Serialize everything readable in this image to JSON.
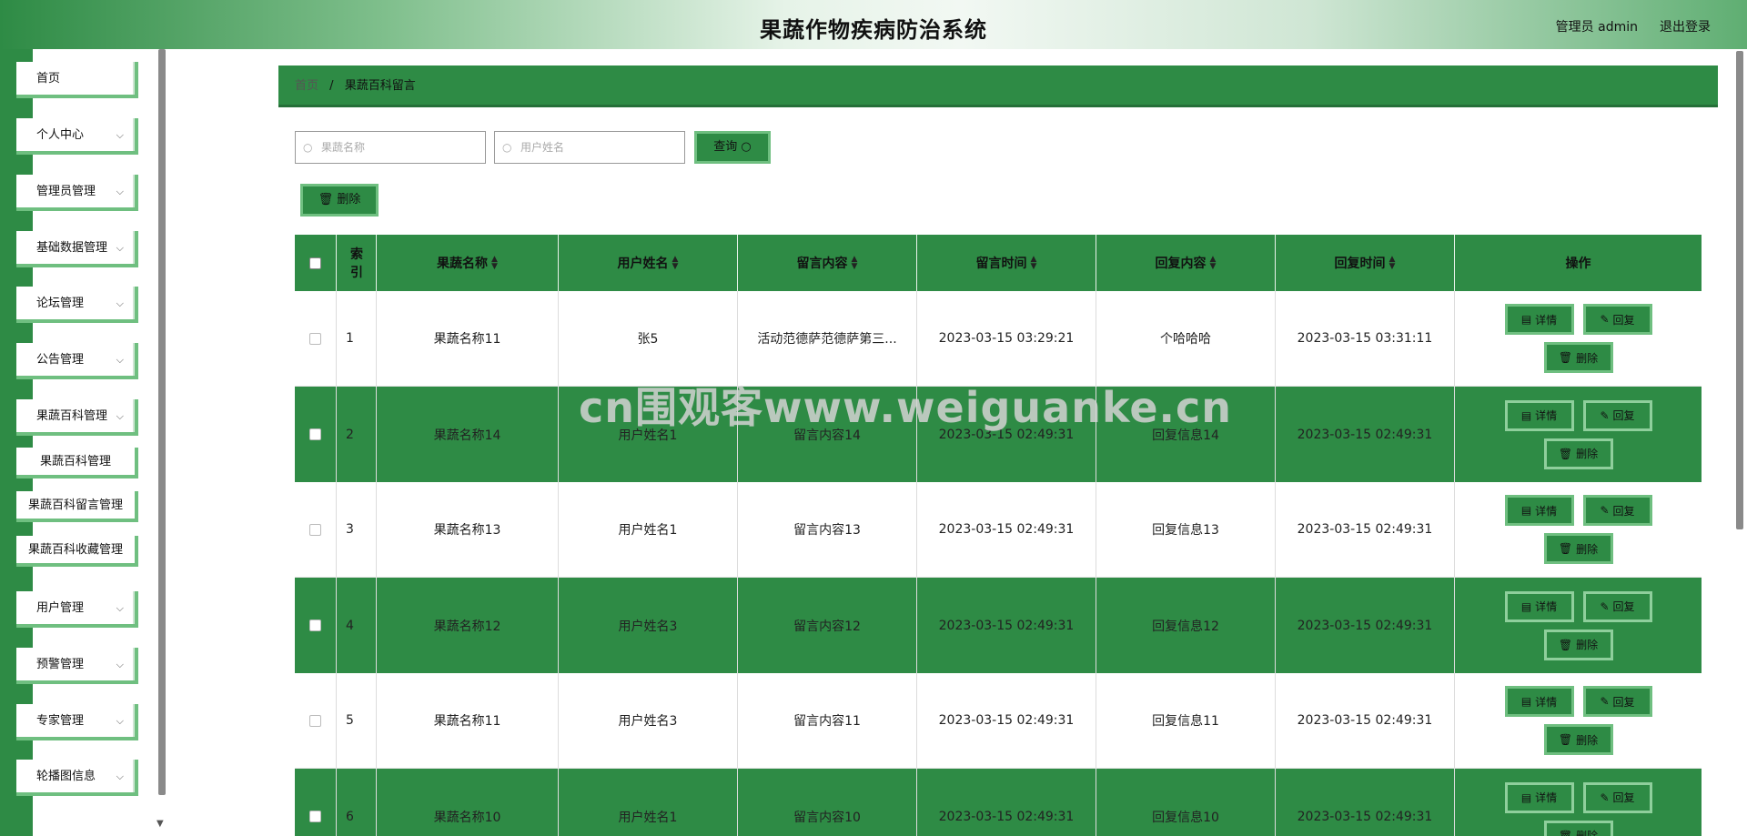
{
  "header": {
    "title": "果蔬作物疾病防治系统",
    "user": "管理员 admin",
    "logout": "退出登录"
  },
  "sidebar": {
    "items": [
      {
        "label": "首页",
        "chevron": false
      },
      {
        "label": "个人中心",
        "chevron": true
      },
      {
        "label": "管理员管理",
        "chevron": true
      },
      {
        "label": "基础数据管理",
        "chevron": true
      },
      {
        "label": "论坛管理",
        "chevron": true
      },
      {
        "label": "公告管理",
        "chevron": true
      },
      {
        "label": "果蔬百科管理",
        "chevron": true
      }
    ],
    "subitems": [
      "果蔬百科管理",
      "果蔬百科留言管理",
      "果蔬百科收藏管理"
    ],
    "items_after": [
      {
        "label": "用户管理",
        "chevron": true
      },
      {
        "label": "预警管理",
        "chevron": true
      },
      {
        "label": "专家管理",
        "chevron": true
      },
      {
        "label": "轮播图信息",
        "chevron": true
      }
    ]
  },
  "breadcrumb": {
    "home": "首页",
    "separator": "/",
    "current": "果蔬百科留言"
  },
  "search": {
    "fruit_placeholder": "果蔬名称",
    "user_placeholder": "用户姓名",
    "query_label": "查询",
    "delete_label": "删除"
  },
  "table": {
    "headers": [
      "索引",
      "果蔬名称",
      "用户姓名",
      "留言内容",
      "留言时间",
      "回复内容",
      "回复时间",
      "操作"
    ],
    "rows": [
      {
        "index": "1",
        "fruit": "果蔬名称11",
        "user": "张5",
        "content": "活动范德萨范德萨第三...",
        "time": "2023-03-15 03:29:21",
        "reply": "个哈哈哈",
        "reply_time": "2023-03-15 03:31:11"
      },
      {
        "index": "2",
        "fruit": "果蔬名称14",
        "user": "用户姓名1",
        "content": "留言内容14",
        "time": "2023-03-15 02:49:31",
        "reply": "回复信息14",
        "reply_time": "2023-03-15 02:49:31"
      },
      {
        "index": "3",
        "fruit": "果蔬名称13",
        "user": "用户姓名1",
        "content": "留言内容13",
        "time": "2023-03-15 02:49:31",
        "reply": "回复信息13",
        "reply_time": "2023-03-15 02:49:31"
      },
      {
        "index": "4",
        "fruit": "果蔬名称12",
        "user": "用户姓名3",
        "content": "留言内容12",
        "time": "2023-03-15 02:49:31",
        "reply": "回复信息12",
        "reply_time": "2023-03-15 02:49:31"
      },
      {
        "index": "5",
        "fruit": "果蔬名称11",
        "user": "用户姓名3",
        "content": "留言内容11",
        "time": "2023-03-15 02:49:31",
        "reply": "回复信息11",
        "reply_time": "2023-03-15 02:49:31"
      },
      {
        "index": "6",
        "fruit": "果蔬名称10",
        "user": "用户姓名1",
        "content": "留言内容10",
        "time": "2023-03-15 02:49:31",
        "reply": "回复信息10",
        "reply_time": "2023-03-15 02:49:31"
      }
    ],
    "actions": {
      "detail": "详情",
      "reply": "回复",
      "delete": "删除"
    }
  },
  "watermark": "cn围观客www.weiguanke.cn",
  "colors": {
    "primary": "#2e8b45",
    "border_light": "#6fbf80"
  },
  "icons": {
    "search": "search-icon",
    "delete": "trash-icon",
    "detail": "document-icon",
    "reply": "edit-icon",
    "chevron": "chevron-down-icon",
    "sort": "sort-icon"
  }
}
